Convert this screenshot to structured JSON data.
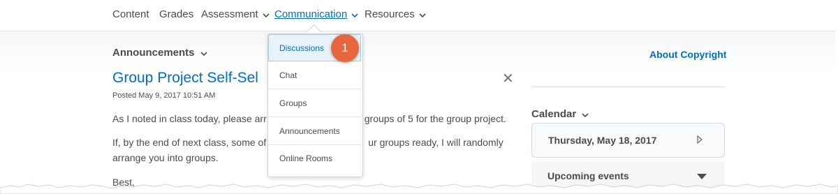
{
  "nav": {
    "items": [
      {
        "label": "Content"
      },
      {
        "label": "Grades"
      },
      {
        "label": "Assessment"
      },
      {
        "label": "Communication"
      },
      {
        "label": "Resources"
      }
    ]
  },
  "announcements": {
    "widget_title": "Announcements",
    "item_title": "Group Project Self-Sel",
    "posted": "Posted May 9, 2017 10:51 AM",
    "para1_start": "As I noted in class today, please arr",
    "para1_end": "groups of 5 for the group project.",
    "para2_line1_start": "If, by the end of next class, some of",
    "para2_line1_end": "ur groups ready, I will randomly",
    "para2_line2": "arrange you into groups.",
    "para3": "Best,"
  },
  "sidebar": {
    "about_copyright": "About Copyright",
    "calendar_title": "Calendar",
    "calendar_date": "Thursday, May 18, 2017",
    "upcoming_events": "Upcoming events"
  },
  "dropdown": {
    "items": [
      {
        "label": "Discussions"
      },
      {
        "label": "Chat"
      },
      {
        "label": "Groups"
      },
      {
        "label": "Announcements"
      },
      {
        "label": "Online Rooms"
      }
    ]
  },
  "badge": {
    "number": "1"
  },
  "colors": {
    "link": "#006fbf",
    "badge": "#e8663d",
    "text": "#494c4e"
  }
}
